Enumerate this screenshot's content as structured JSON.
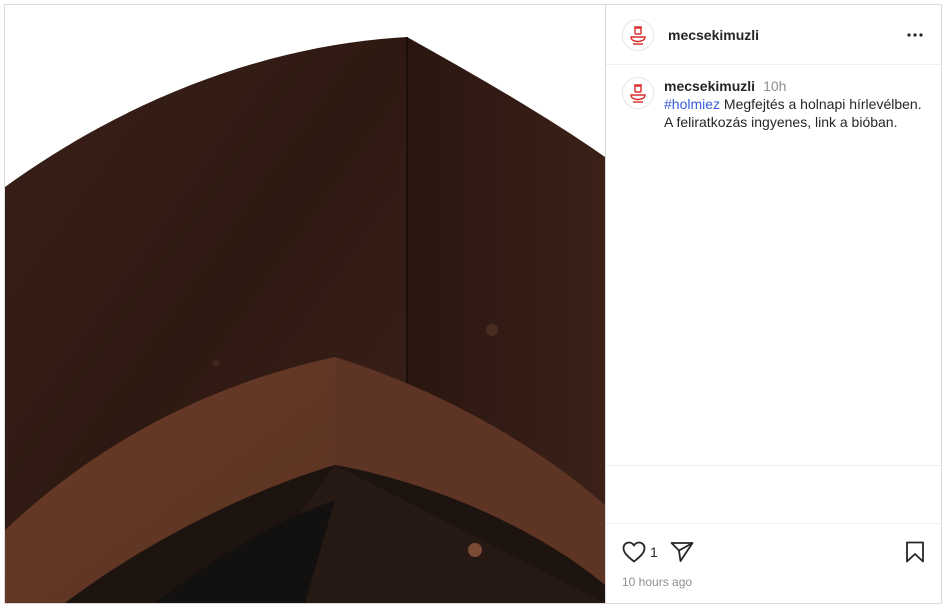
{
  "post": {
    "username": "mecsekimuzli",
    "caption": {
      "username": "mecsekimuzli",
      "relative_time": "10h",
      "hashtag": "#holmiez",
      "text": " Megfejtés a holnapi hírlevélben. A feliratkozás ingyenes, link a bióban."
    },
    "likes": "1",
    "timestamp": "10 hours ago"
  },
  "colors": {
    "hashtag": "#385ce2",
    "border": "#dbdbdb",
    "secondary_text": "#8e8e8e",
    "logo_red": "#d92b2b"
  },
  "icons": {
    "avatar": "museum-logo-icon",
    "more": "more-horizontal-icon",
    "like": "heart-icon",
    "share": "send-icon",
    "save": "bookmark-icon"
  }
}
